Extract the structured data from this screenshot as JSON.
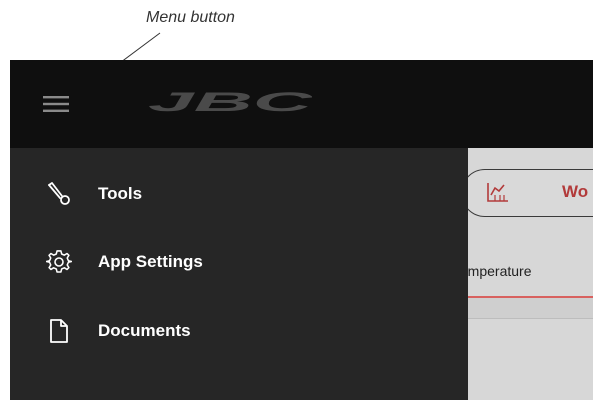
{
  "annotation": {
    "menu_button_label": "Menu button"
  },
  "header": {
    "logo_text": "JBC",
    "menu_icon": "hamburger-menu-icon",
    "background_color": "#0f0f0f"
  },
  "drawer": {
    "background_color": "#262626",
    "items": [
      {
        "label": "Tools",
        "icon": "tool-icon"
      },
      {
        "label": "App Settings",
        "icon": "gear-icon"
      },
      {
        "label": "Documents",
        "icon": "document-icon"
      }
    ]
  },
  "content": {
    "work_button_label": "Wo",
    "work_button_icon": "chart-icon",
    "temperature_tab_label": "temperature",
    "accent_color": "#b23a3a"
  }
}
